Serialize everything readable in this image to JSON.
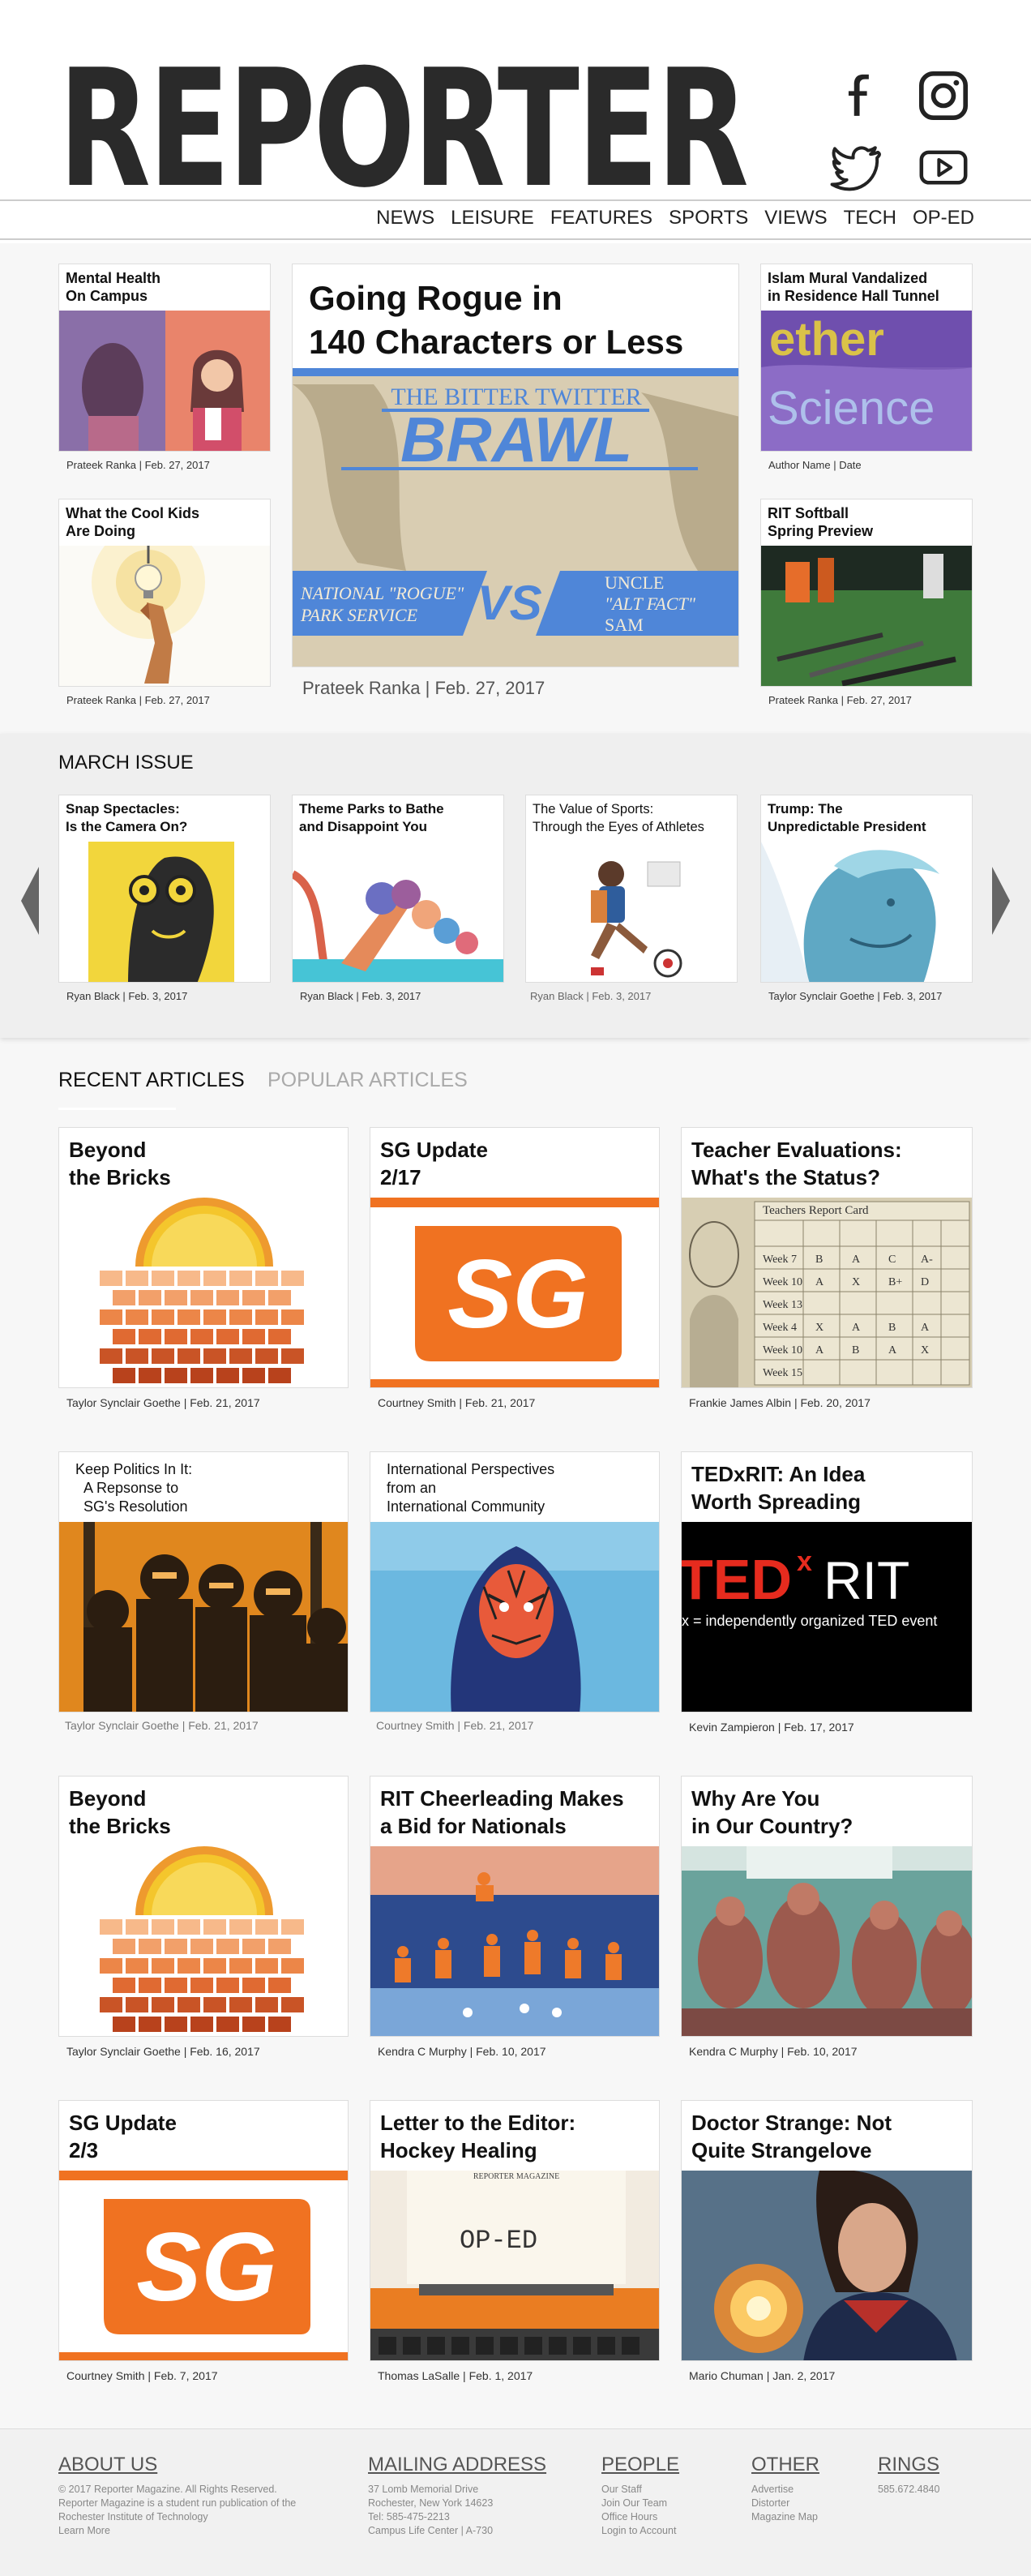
{
  "brand": {
    "logo": "REPORTER"
  },
  "social": [
    "facebook-icon",
    "instagram-icon",
    "twitter-icon",
    "youtube-icon"
  ],
  "nav": [
    "NEWS",
    "LEISURE",
    "FEATURES",
    "SPORTS",
    "VIEWS",
    "TECH",
    "OP-ED"
  ],
  "top": {
    "left": [
      {
        "title": "Mental Health\nOn Campus",
        "byline": "Prateek Ranka | Feb. 27, 2017"
      },
      {
        "title": "What the Cool Kids\nAre Doing",
        "byline": "Prateek Ranka | Feb. 27, 2017"
      }
    ],
    "hero": {
      "title": "Going Rogue in\n140 Characters or Less",
      "byline": "Prateek Ranka | Feb. 27, 2017",
      "image_text": {
        "top": "THE BITTER TWITTER",
        "main": "BRAWL",
        "left": "NATIONAL \"ROGUE\"\nPARK SERVICE",
        "vs": "VS.",
        "right": "UNCLE\n\"ALT FACT\"\nSAM"
      }
    },
    "right": [
      {
        "title": "Islam Mural Vandalized\nin Residence Hall Tunnel",
        "byline": "Author Name | Date",
        "image_text": "ether\nScience"
      },
      {
        "title": "RIT Softball\nSpring Preview",
        "byline": "Prateek Ranka | Feb. 27, 2017"
      }
    ]
  },
  "march": {
    "title": "MARCH ISSUE",
    "items": [
      {
        "title": "Snap Spectacles:\nIs the Camera On?",
        "byline": "Ryan Black | Feb. 3, 2017"
      },
      {
        "title": "Theme Parks to Bathe\nand Disappoint You",
        "byline": "Ryan Black | Feb. 3, 2017"
      },
      {
        "title": "The Value of Sports:\nThrough the Eyes of Athletes",
        "byline": "Ryan Black | Feb. 3, 2017"
      },
      {
        "title": "Trump: The\nUnpredictable President",
        "byline": "Taylor Synclair Goethe | Feb. 3, 2017"
      }
    ]
  },
  "tabs": {
    "recent": "RECENT ARTICLES",
    "popular": "POPULAR ARTICLES"
  },
  "articles": [
    {
      "title": "Beyond\nthe Bricks",
      "byline": "Taylor Synclair Goethe | Feb. 21, 2017",
      "style": "big"
    },
    {
      "title": "SG Update\n2/17",
      "byline": "Courtney Smith | Feb. 21, 2017",
      "style": "big",
      "image_text": "SG"
    },
    {
      "title": "Teacher Evaluations:\nWhat's the Status?",
      "byline": "Frankie James Albin | Feb. 20, 2017",
      "style": "big",
      "image_text": "Teachers Report Card"
    },
    {
      "title": "Keep Politics In It:\n  A Repsonse to\n  SG's Resolution",
      "byline": "Taylor Synclair Goethe | Feb. 21, 2017",
      "style": "small"
    },
    {
      "title": "International Perspectives\nfrom an\nInternational Community",
      "byline": "Courtney Smith | Feb. 21, 2017",
      "style": "small"
    },
    {
      "title": "TEDxRIT: An Idea\nWorth Spreading",
      "byline": "Kevin Zampieron | Feb. 17, 2017",
      "style": "big",
      "image_text": {
        "ted": "TED",
        "x": "x",
        "rit": "RIT",
        "sub": "x = independently organized TED event"
      }
    },
    {
      "title": "Beyond\nthe Bricks",
      "byline": "Taylor Synclair Goethe | Feb. 16, 2017",
      "style": "big"
    },
    {
      "title": "RIT Cheerleading Makes\na Bid for Nationals",
      "byline": "Kendra C Murphy | Feb. 10, 2017",
      "style": "big"
    },
    {
      "title": "Why Are You\nin Our Country?",
      "byline": "Kendra C Murphy | Feb. 10, 2017",
      "style": "big"
    },
    {
      "title": "SG Update\n2/3",
      "byline": "Courtney Smith | Feb. 7, 2017",
      "style": "big",
      "image_text": "SG"
    },
    {
      "title": "Letter to the Editor:\nHockey Healing",
      "byline": "Thomas LaSalle | Feb. 1, 2017",
      "style": "big",
      "image_text": {
        "mast": "REPORTER MAGAZINE",
        "op": "OP-ED"
      }
    },
    {
      "title": "Doctor Strange: Not\nQuite Strangelove",
      "byline": "Mario Chuman | Jan. 2, 2017",
      "style": "big"
    }
  ],
  "footer": {
    "about": {
      "title": "ABOUT US",
      "lines": [
        "© 2017 Reporter Magazine. All Rights Reserved.",
        "Reporter Magazine is a student run publication of the",
        "Rochester Institute of Technology",
        "Learn More"
      ]
    },
    "mailing": {
      "title": "MAILING ADDRESS",
      "lines": [
        "37 Lomb Memorial Drive",
        "Rochester, New York 14623",
        "Tel: 585-475-2213",
        "Campus Life Center | A-730"
      ]
    },
    "people": {
      "title": "PEOPLE",
      "lines": [
        "Our Staff",
        "Join Our Team",
        "Office Hours",
        "Login to Account"
      ]
    },
    "other": {
      "title": "OTHER",
      "lines": [
        "Advertise",
        "Distorter",
        "Magazine Map"
      ]
    },
    "rings": {
      "title": "RINGS",
      "lines": [
        "585.672.4840"
      ]
    }
  }
}
